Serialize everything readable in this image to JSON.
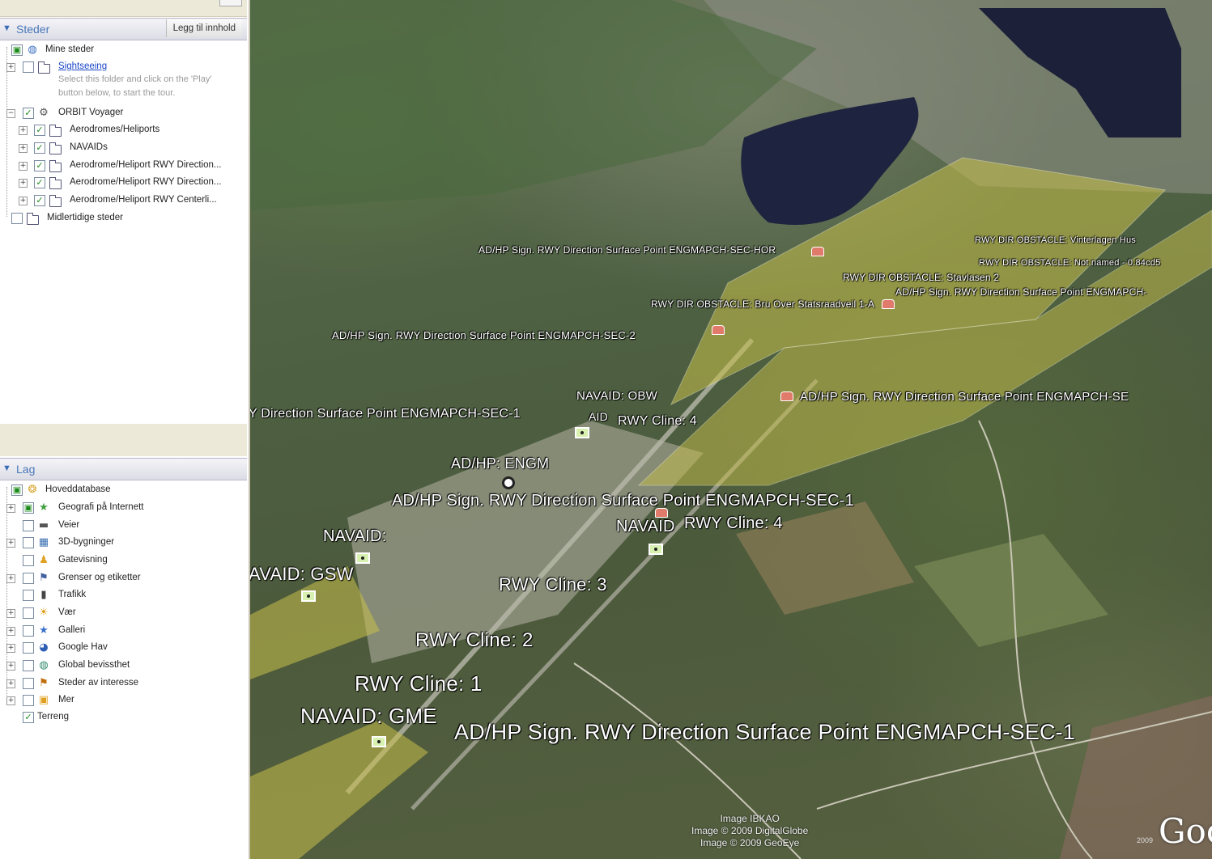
{
  "places_panel": {
    "title": "Steder",
    "add_content_button": "Legg til innhold",
    "items": [
      {
        "label": "Mine steder"
      },
      {
        "label": "Sightseeing",
        "description_line1": "Select this folder and click on the 'Play'",
        "description_line2": "button below, to start the tour."
      },
      {
        "label": "ORBIT Voyager"
      },
      {
        "label": "Aerodromes/Heliports"
      },
      {
        "label": "NAVAIDs"
      },
      {
        "label": "Aerodrome/Heliport RWY Direction..."
      },
      {
        "label": "Aerodrome/Heliport RWY Direction..."
      },
      {
        "label": "Aerodrome/Heliport RWY Centerli..."
      },
      {
        "label": "Midlertidige steder"
      }
    ]
  },
  "layers_panel": {
    "title": "Lag",
    "items": [
      {
        "label": "Hoveddatabase"
      },
      {
        "label": "Geografi på Internett"
      },
      {
        "label": "Veier"
      },
      {
        "label": "3D-bygninger"
      },
      {
        "label": "Gatevisning"
      },
      {
        "label": "Grenser og etiketter"
      },
      {
        "label": "Trafikk"
      },
      {
        "label": "Vær"
      },
      {
        "label": "Galleri"
      },
      {
        "label": "Google Hav"
      },
      {
        "label": "Global bevissthet"
      },
      {
        "label": "Steder av interesse"
      },
      {
        "label": "Mer"
      },
      {
        "label": "Terreng"
      }
    ]
  },
  "map_labels": {
    "l1": "AD/HP Sign. RWY Direction Surface Point ENGMAPCH-SEC-HOR",
    "l2": "RWY DIR OBSTACLE: Vinterlagen Hus",
    "l3": "RWY DIR OBSTACLE: Not named - 0.84cd5",
    "l4": "RWY DIR OBSTACLE: Stavlasen 2",
    "l5": "AD/HP Sign. RWY Direction Surface Point ENGMAPCH-",
    "l6": "RWY DIR OBSTACLE: Bru Over Statsraadveil 1-A",
    "l7": "AD/HP Sign. RWY Direction Surface Point ENGMAPCH-SEC-2",
    "l8": "NAVAID: OBW",
    "l9": "AD/HP Sign. RWY Direction Surface Point ENGMAPCH-SE",
    "l10": "Y Direction Surface Point ENGMAPCH-SEC-1",
    "l11": "AID",
    "l12": "RWY Cline: 4",
    "l13": "AD/HP: ENGM",
    "l14": "AD/HP Sign. RWY Direction Surface Point ENGMAPCH-SEC-1",
    "l15": "NAVAID",
    "l16": "RWY Cline: 4",
    "l17": "NAVAID:",
    "l18": "AVAID: GSW",
    "l19": "RWY Cline: 3",
    "l20": "RWY Cline: 2",
    "l21": "RWY Cline: 1",
    "l22": "NAVAID: GME",
    "l23": "AD/HP Sign. RWY Direction Surface Point ENGMAPCH-SEC-1"
  },
  "credits": {
    "line1": "Image IBKAO",
    "line2": "Image © 2009 DigitalGlobe",
    "line3": "Image © 2009 GeoEye",
    "logo": "Goo",
    "year": "2009"
  },
  "colors": {
    "panel_header_text": "#4a79b8",
    "overlay_fill": "#c8c04a",
    "water": "#1e2440"
  }
}
